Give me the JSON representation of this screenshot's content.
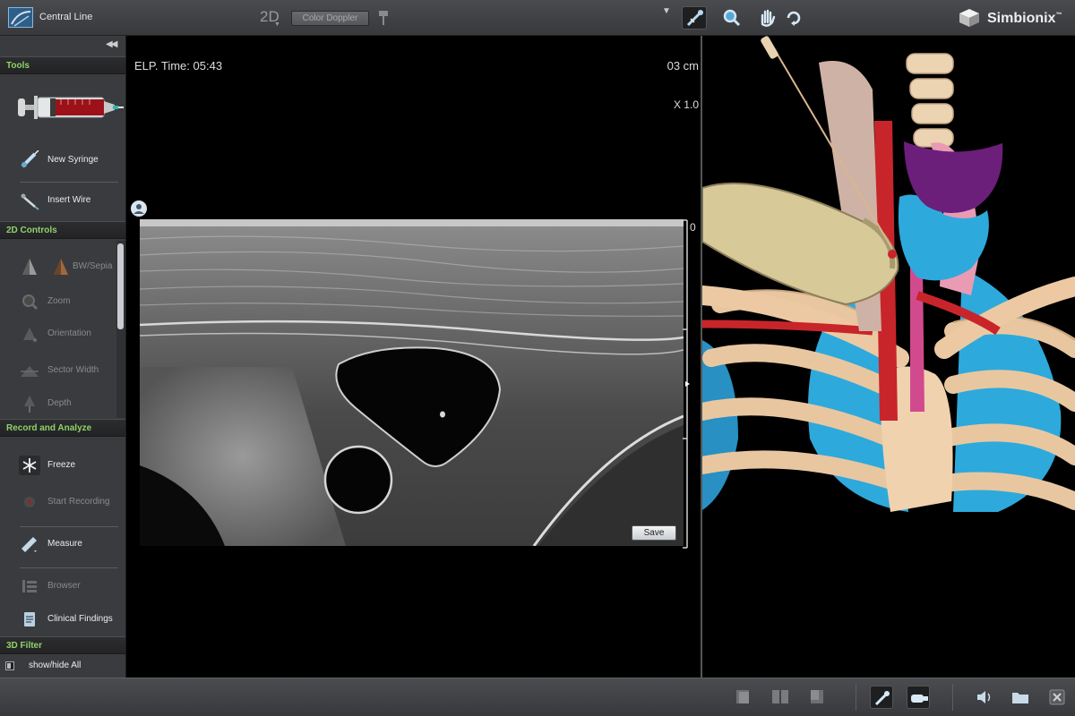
{
  "app": {
    "title": "Central Line",
    "brand": "Simbionix",
    "brand_mark": "™"
  },
  "toolbar": {
    "mode": "2D",
    "color_doppler_label": "Color Doppler"
  },
  "panel": {
    "sections": {
      "tools": "Tools",
      "controls_2d": "2D Controls",
      "record": "Record and Analyze",
      "filter_3d": "3D Filter"
    },
    "tools": [
      {
        "label": "New Syringe"
      },
      {
        "label": "Insert Wire"
      }
    ],
    "controls_2d": [
      {
        "label": "BW/Sepia"
      },
      {
        "label": "Zoom"
      },
      {
        "label": "Orientation"
      },
      {
        "label": "Sector Width"
      },
      {
        "label": "Depth"
      }
    ],
    "record": [
      {
        "label": "Freeze"
      },
      {
        "label": "Start Recording"
      },
      {
        "label": "Measure"
      },
      {
        "label": "Browser"
      },
      {
        "label": "Clinical Findings"
      }
    ],
    "filter_3d": {
      "label": "show/hide All"
    }
  },
  "ultrasound": {
    "elapsed_time": "ELP. Time: 05:43",
    "depth": "03 cm",
    "zoom": "X 1.0",
    "scale_zero": "0",
    "save_label": "Save"
  },
  "colors": {
    "section_text": "#8fd36a",
    "panel_bg": "#3a3b3e",
    "artery": "#c8252a",
    "vein": "#2ea9dc",
    "bone": "#e8c7a0",
    "thyroid": "#6b1f7a"
  }
}
